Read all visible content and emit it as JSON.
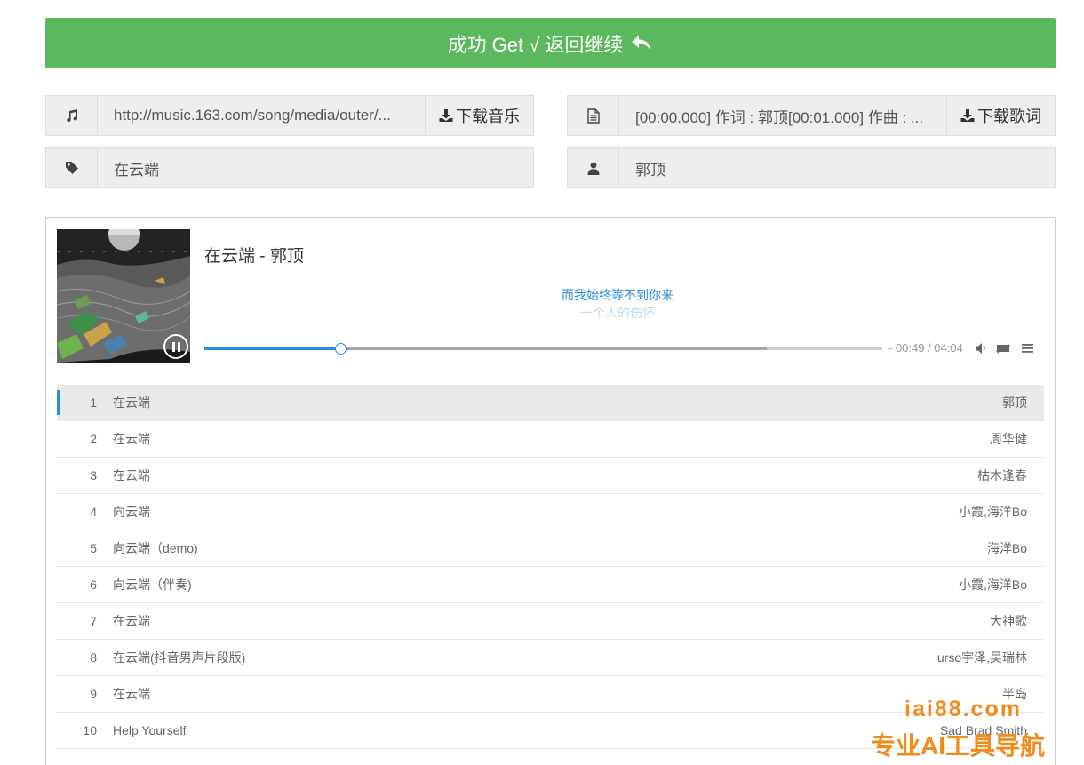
{
  "banner": {
    "label": "成功 Get √ 返回继续"
  },
  "fields": {
    "music_url": {
      "icon": "music-note-icon",
      "value": "http://music.163.com/song/media/outer/...",
      "button": "下载音乐"
    },
    "lyrics": {
      "icon": "document-icon",
      "value": "[00:00.000] 作词 : 郭顶[00:01.000] 作曲 : ...",
      "button": "下载歌词"
    },
    "title": {
      "icon": "tag-icon",
      "value": "在云端"
    },
    "artist": {
      "icon": "user-icon",
      "value": "郭顶"
    }
  },
  "player": {
    "now_playing": "在云端 - 郭顶",
    "lyric_current": "而我始终等不到你来",
    "lyric_next": "一个人的伤怀",
    "time": "- 00:49 / 04:04",
    "progress_fraction": 0.2,
    "buffered_fraction": 0.83,
    "controls": [
      "volume-icon",
      "loop-icon",
      "playlist-menu-icon"
    ]
  },
  "playlist": [
    {
      "num": "1",
      "name": "在云端",
      "artist": "郭顶"
    },
    {
      "num": "2",
      "name": "在云端",
      "artist": "周华健"
    },
    {
      "num": "3",
      "name": "在云端",
      "artist": "枯木逢春"
    },
    {
      "num": "4",
      "name": "向云端",
      "artist": "小霞,海洋Bo"
    },
    {
      "num": "5",
      "name": "向云端（demo)",
      "artist": "海洋Bo"
    },
    {
      "num": "6",
      "name": "向云端（伴奏)",
      "artist": "小霞,海洋Bo"
    },
    {
      "num": "7",
      "name": "在云端",
      "artist": "大神歌"
    },
    {
      "num": "8",
      "name": "在云端(抖音男声片段版)",
      "artist": "urso宇泽,吴瑞林"
    },
    {
      "num": "9",
      "name": "在云端",
      "artist": "半岛"
    },
    {
      "num": "10",
      "name": "Help Yourself",
      "artist": "Sad Brad Smith"
    }
  ],
  "watermark": {
    "line1": "iai88.com",
    "line2": "专业AI工具导航"
  },
  "colors": {
    "success": "#5cb85c",
    "accent": "#2b8ed6",
    "watermark": "#f08c1a"
  }
}
